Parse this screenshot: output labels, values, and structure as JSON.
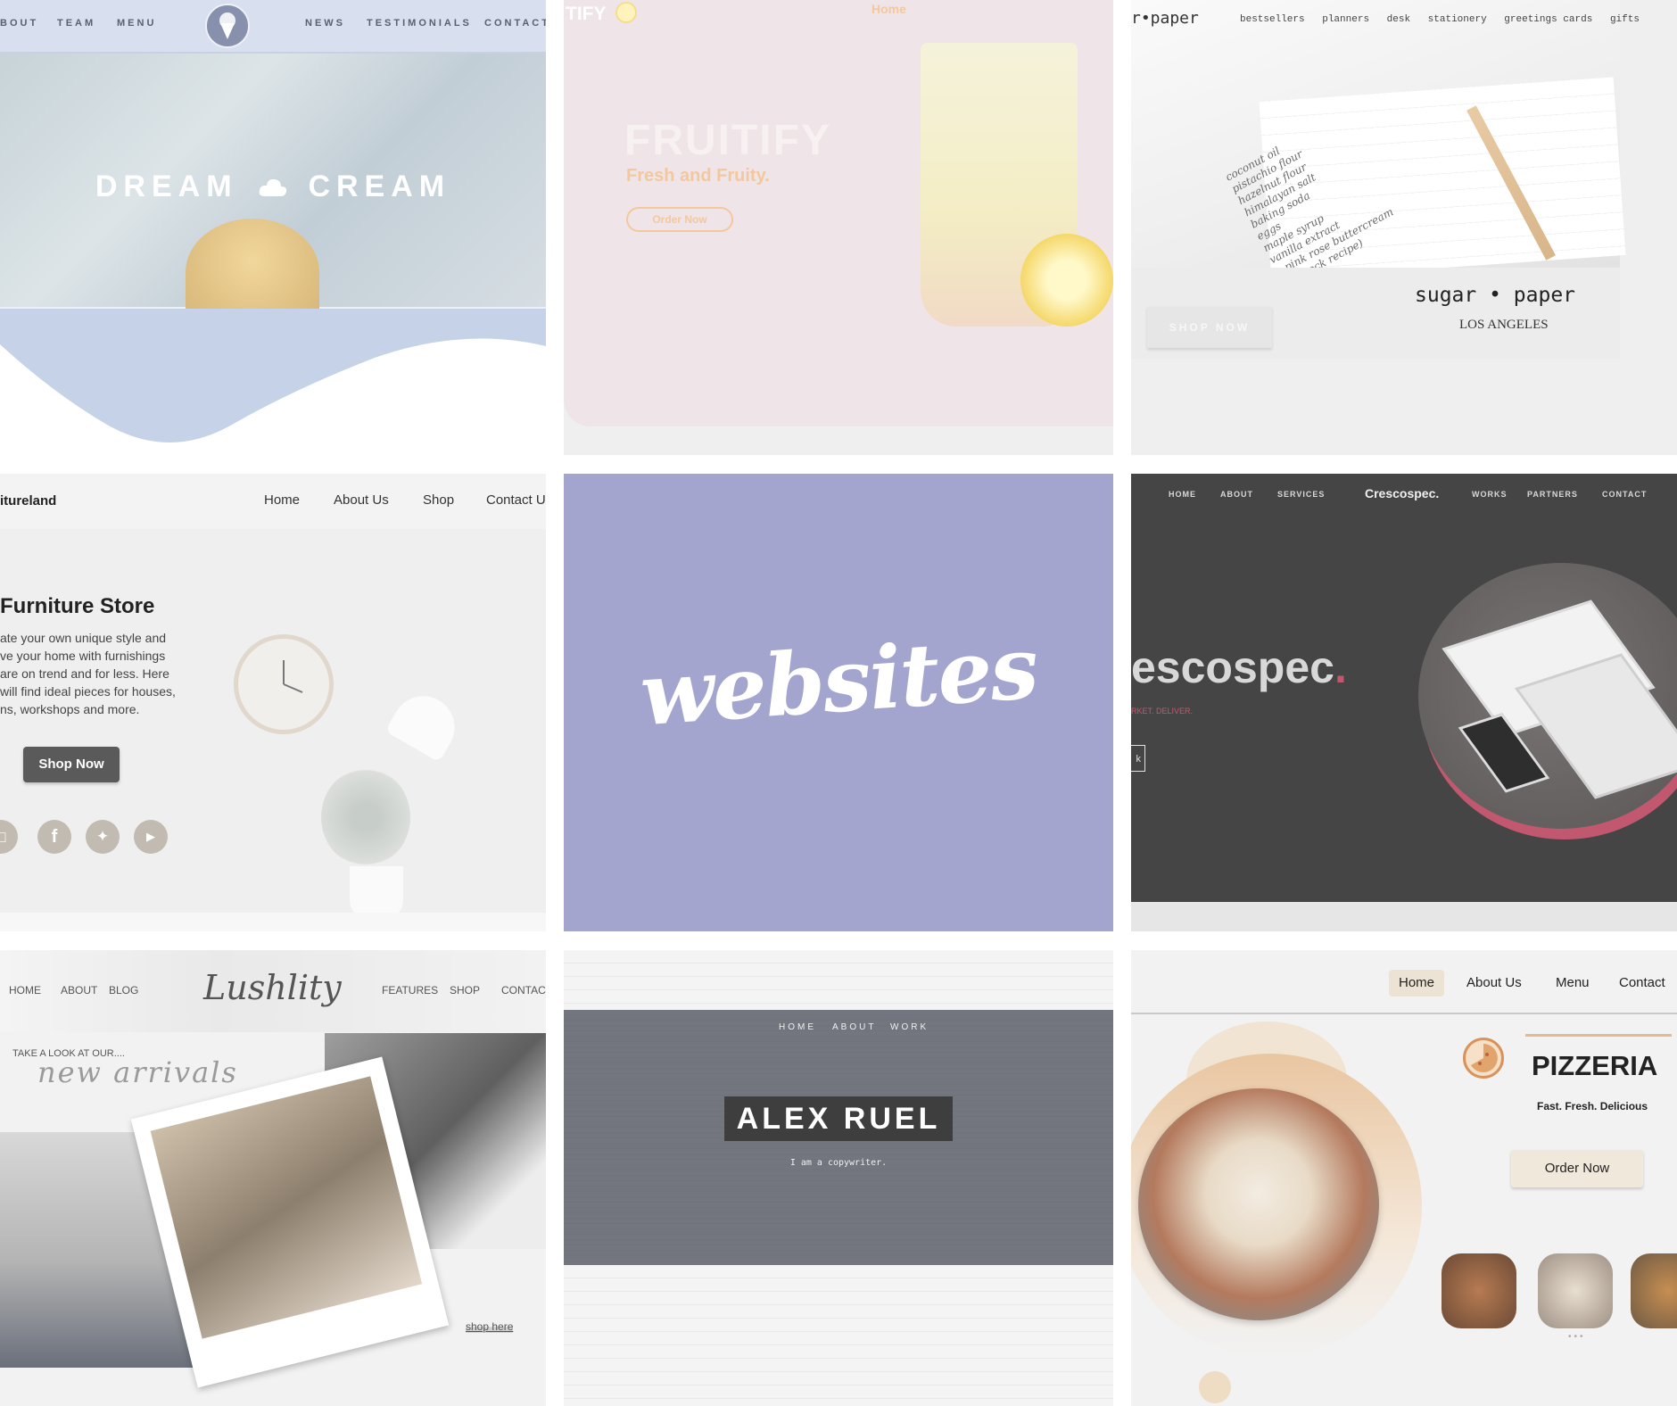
{
  "dream_cream": {
    "nav_left": [
      "BOUT",
      "TEAM",
      "MENU"
    ],
    "nav_right": [
      "NEWS",
      "TESTIMONIALS",
      "CONTACT"
    ],
    "title_left": "DREAM",
    "title_right": "CREAM",
    "logo_icon": "ice-cream-cone-icon",
    "colors": {
      "nav": "#d8dfee",
      "wave": "#c6d2e7"
    }
  },
  "fruitify": {
    "brand_partial": "TIFY",
    "nav_home": "Home",
    "title": "FRUITIFY",
    "tagline": "Fresh and Fruity.",
    "cta": "Order Now",
    "colors": {
      "accent": "#f3c89e",
      "bg": "#efe4e8"
    }
  },
  "sugar_paper": {
    "brand_partial": "r•paper",
    "nav": [
      "bestsellers",
      "planners",
      "desk",
      "stationery",
      "greetings cards",
      "gifts"
    ],
    "brand": "sugar • paper",
    "city": "LOS ANGELES",
    "cta": "SHOP NOW",
    "note_lines": [
      "coconut oil",
      "pistachio flour",
      "hazelnut flour",
      "himalayan salt",
      "baking soda",
      "eggs",
      "maple syrup",
      "vanilla extract",
      "• pink rose buttercream",
      "(+ check recipe)"
    ]
  },
  "furniture": {
    "brand_partial": "itureland",
    "nav": [
      "Home",
      "About Us",
      "Shop",
      "Contact U"
    ],
    "heading": "Furniture Store",
    "body_lines": [
      "ate your own unique style and",
      "ve your home  with furnishings",
      "are on trend and for less. Here",
      "will find ideal pieces for houses,",
      "ns, workshops and more."
    ],
    "cta": "Shop Now",
    "social_icons": [
      "instagram-icon",
      "facebook-icon",
      "twitter-icon",
      "youtube-icon"
    ]
  },
  "websites": {
    "word": "websites",
    "colors": {
      "bg": "#a4a5cf"
    }
  },
  "crescospec": {
    "nav_left": [
      "HOME",
      "ABOUT",
      "SERVICES"
    ],
    "logo": "Crescospec.",
    "nav_right": [
      "WORKS",
      "PARTNERS",
      "CONTACT"
    ],
    "hero_text": "escospec",
    "hero_dot": ".",
    "tagline": "RKET. DELIVER.",
    "button_partial": "k",
    "colors": {
      "bg": "#454545",
      "accent": "#c2586f"
    }
  },
  "lushlity": {
    "nav_left": [
      "HOME",
      "ABOUT",
      "BLOG"
    ],
    "logo": "Lushlity",
    "nav_right": [
      "FEATURES",
      "SHOP",
      "CONTACT"
    ],
    "kicker": "TAKE A LOOK AT OUR....",
    "script_heading": "new arrivals",
    "link": "shop here"
  },
  "alex_ruel": {
    "nav": [
      "HOME",
      "ABOUT",
      "WORK"
    ],
    "name": "ALEX RUEL",
    "subtitle": "I am a copywriter.",
    "colors": {
      "band": "#74767f",
      "badge": "#3e3e3e"
    }
  },
  "pizzeria": {
    "nav": [
      "Home",
      "About Us",
      "Menu",
      "Contact"
    ],
    "title": "PIZZERIA",
    "tagline": "Fast. Fresh. Delicious",
    "cta": "Order Now",
    "logo_icon": "pizza-icon",
    "colors": {
      "accent": "#e8b98e",
      "button": "#efe8db"
    }
  }
}
